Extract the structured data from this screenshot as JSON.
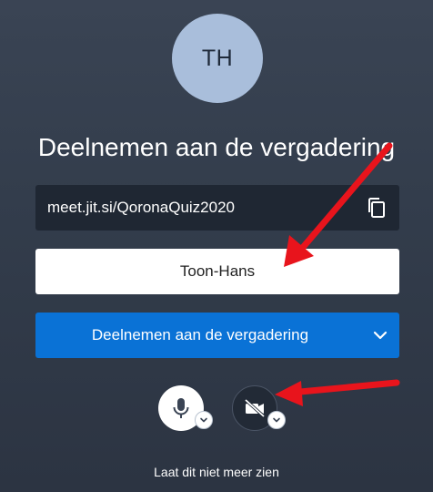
{
  "avatar": {
    "initials": "TH",
    "color": "#a9bedb"
  },
  "title": "Deelnemen aan de vergadering",
  "meeting": {
    "url": "meet.jit.si/QoronaQuiz2020",
    "copy_icon": "copy-icon"
  },
  "name_input": {
    "value": "Toon-Hans"
  },
  "join_button": {
    "label": "Deelnemen aan de vergadering",
    "color": "#0a72d6",
    "options_icon": "chevron-down-icon"
  },
  "media": {
    "microphone": {
      "icon": "microphone-icon",
      "state": "on"
    },
    "camera": {
      "icon": "camera-off-icon",
      "state": "off"
    }
  },
  "footer": {
    "dont_show_again": "Laat dit niet meer zien"
  },
  "annotation": {
    "arrow_color": "#e8141c"
  }
}
